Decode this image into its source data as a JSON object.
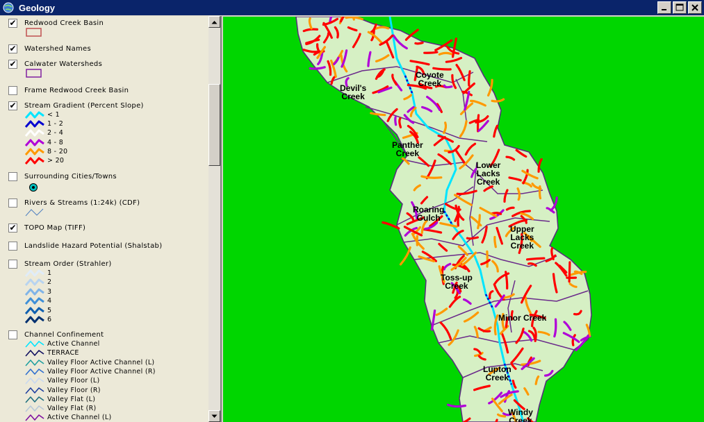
{
  "window": {
    "title": "Geology"
  },
  "toc": {
    "layers": [
      {
        "name": "Redwood Creek Basin",
        "checked": true
      },
      {
        "name": "Watershed Names",
        "checked": true
      },
      {
        "name": "Calwater Watersheds",
        "checked": true
      },
      {
        "name": "Frame Redwood Creek Basin",
        "checked": false
      },
      {
        "name": "Stream Gradient (Percent Slope)",
        "checked": true
      },
      {
        "name": "Surrounding Cities/Towns",
        "checked": false
      },
      {
        "name": "Rivers & Streams (1:24k) (CDF)",
        "checked": false
      },
      {
        "name": "TOPO Map (TIFF)",
        "checked": true
      },
      {
        "name": "Landslide Hazard Potential (Shalstab)",
        "checked": false
      },
      {
        "name": "Stream Order (Strahler)",
        "checked": false
      },
      {
        "name": "Channel Confinement",
        "checked": false
      }
    ],
    "stream_gradient_classes": [
      {
        "label": "< 1",
        "color": "#00e5ff"
      },
      {
        "label": "1 - 2",
        "color": "#0000d0"
      },
      {
        "label": "2 - 4",
        "color": "#ffffff"
      },
      {
        "label": "4 - 8",
        "color": "#b000d8"
      },
      {
        "label": "8 - 20",
        "color": "#ff9900"
      },
      {
        "label": "> 20",
        "color": "#ff0000"
      }
    ],
    "stream_order_classes": [
      {
        "label": "1",
        "color": "#e0ecf8"
      },
      {
        "label": "2",
        "color": "#b8d4f0"
      },
      {
        "label": "3",
        "color": "#80b4e8"
      },
      {
        "label": "4",
        "color": "#4090d8"
      },
      {
        "label": "5",
        "color": "#1060b0"
      },
      {
        "label": "6",
        "color": "#003070"
      }
    ],
    "channel_confinement_classes": [
      {
        "label": "Active Channel",
        "color": "#00e5ff"
      },
      {
        "label": "TERRACE",
        "color": "#101060"
      },
      {
        "label": "Valley Floor Active Channel (L)",
        "color": "#20a0a0"
      },
      {
        "label": "Valley Floor Active Channel (R)",
        "color": "#3070d0"
      },
      {
        "label": "Valley Floor (L)",
        "color": "#c8d8f0"
      },
      {
        "label": "Valley Floor (R)",
        "color": "#2040a0"
      },
      {
        "label": "Valley Flat (L)",
        "color": "#207080"
      },
      {
        "label": "Valley Flat (R)",
        "color": "#b8c8d8"
      },
      {
        "label": "Active Channel (L)",
        "color": "#8010a0"
      }
    ]
  },
  "map": {
    "background_color": "#00d600",
    "terrain_color": "#d6f0c4",
    "watershed_labels": [
      {
        "lines": [
          "Coyote",
          "Creek"
        ]
      },
      {
        "lines": [
          "Devil's",
          "Creek"
        ]
      },
      {
        "lines": [
          "Panther",
          "Creek"
        ]
      },
      {
        "lines": [
          "Lower",
          "Lacks",
          "Creek"
        ]
      },
      {
        "lines": [
          "Roaring",
          "Gulch"
        ]
      },
      {
        "lines": [
          "Upper",
          "Lacks",
          "Creek"
        ]
      },
      {
        "lines": [
          "Toss-up",
          "Creek"
        ]
      },
      {
        "lines": [
          "Minor Creek"
        ]
      },
      {
        "lines": [
          "Lupton",
          "Creek"
        ]
      },
      {
        "lines": [
          "Windy",
          "Creek"
        ]
      }
    ]
  }
}
